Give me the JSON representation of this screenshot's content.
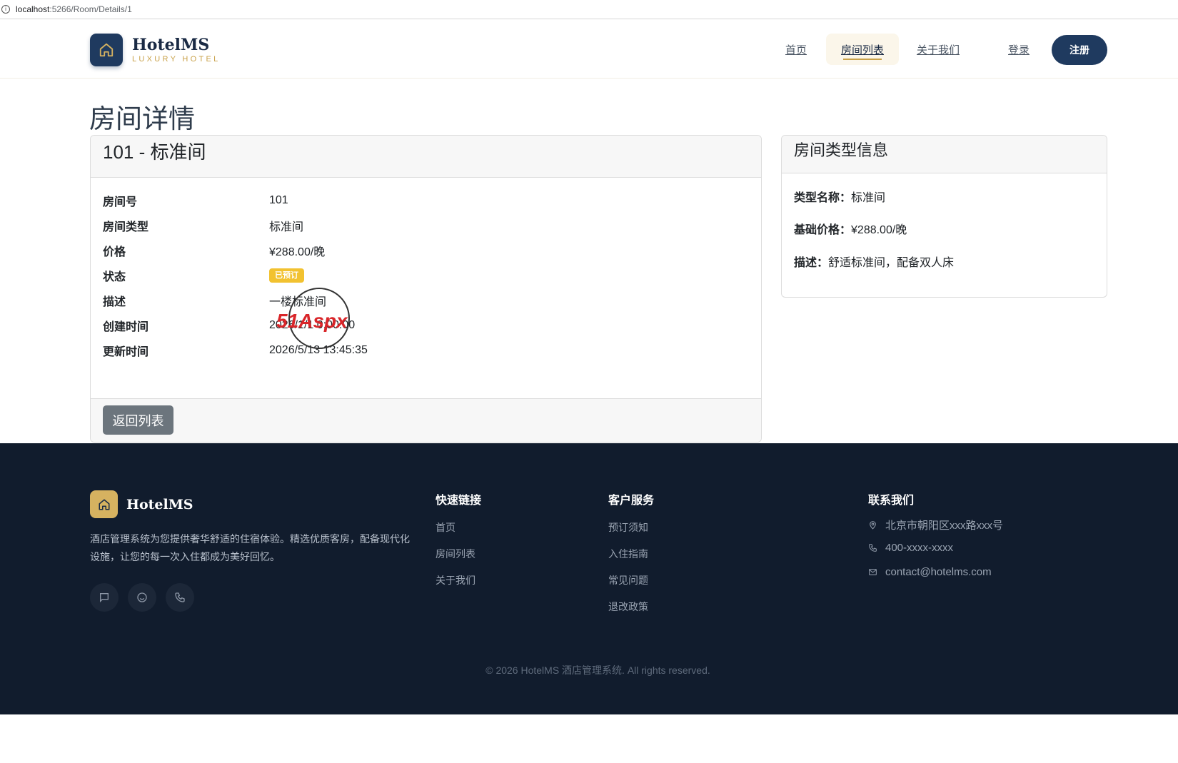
{
  "browser": {
    "url_host": "localhost",
    "url_path": ":5266/Room/Details/1"
  },
  "header": {
    "brand_name": "HotelMS",
    "brand_sub": "LUXURY HOTEL",
    "nav": {
      "home": "首页",
      "rooms": "房间列表",
      "about": "关于我们",
      "login": "登录",
      "register": "注册"
    }
  },
  "page": {
    "title": "房间详情"
  },
  "room_card": {
    "title": "101 - 标准间",
    "rows": [
      {
        "label": "房间号",
        "value": "101"
      },
      {
        "label": "房间类型",
        "value": "标准间"
      },
      {
        "label": "价格",
        "value": "¥288.00/晚"
      },
      {
        "label": "状态",
        "value": "已预订"
      },
      {
        "label": "描述",
        "value": "一楼标准间"
      },
      {
        "label": "创建时间",
        "value": "2026/1/1 0:00:00"
      },
      {
        "label": "更新时间",
        "value": "2026/5/13 13:45:35"
      }
    ],
    "status_color": "#f2c230",
    "back_button": "返回列表"
  },
  "type_card": {
    "title": "房间类型信息",
    "rows": [
      {
        "label": "类型名称：",
        "value": "标准间"
      },
      {
        "label": "基础价格：",
        "value": "¥288.00/晚"
      },
      {
        "label": "描述：",
        "value": "舒适标准间，配备双人床"
      }
    ]
  },
  "watermark": {
    "text": "51Aspx"
  },
  "footer": {
    "brand_name": "HotelMS",
    "description": "酒店管理系统为您提供奢华舒适的住宿体验。精选优质客房，配备现代化设施，让您的每一次入住都成为美好回忆。",
    "socials": [
      "chat-icon",
      "smile-icon",
      "phone-icon"
    ],
    "quick_links": {
      "title": "快速链接",
      "items": [
        "首页",
        "房间列表",
        "关于我们"
      ]
    },
    "service": {
      "title": "客户服务",
      "items": [
        "预订须知",
        "入住指南",
        "常见问题",
        "退改政策"
      ]
    },
    "contact": {
      "title": "联系我们",
      "address": "北京市朝阳区xxx路xxx号",
      "phone": "400-xxxx-xxxx",
      "email": "contact@hotelms.com"
    },
    "copyright": "© 2026 HotelMS 酒店管理系统. All rights reserved."
  },
  "colors": {
    "primary": "#1f3a5f",
    "gold": "#c9a24a",
    "footer_bg": "#111c2d",
    "secondary_button": "#6c757d"
  }
}
